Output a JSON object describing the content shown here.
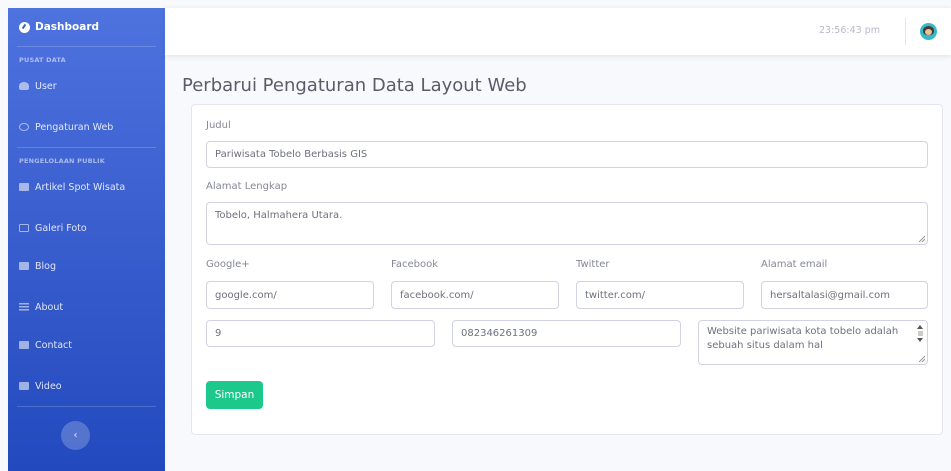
{
  "sidebar": {
    "brand": "Dashboard",
    "heading_1": "PUSAT DATA",
    "heading_2": "PENGELOLAAN PUBLIK",
    "items": {
      "user": "User",
      "web_settings": "Pengaturan Web",
      "articles": "Artikel Spot Wisata",
      "gallery": "Galeri Foto",
      "blog": "Blog",
      "about": "About",
      "contact": "Contact",
      "video": "Video"
    },
    "toggle_symbol": "‹"
  },
  "topbar": {
    "time": "23:56:43 pm"
  },
  "page": {
    "title": "Perbarui Pengaturan Data Layout Web"
  },
  "form": {
    "judul_label": "Judul",
    "judul_value": "Pariwisata Tobelo Berbasis GIS",
    "alamat_label": "Alamat Lengkap",
    "alamat_value": "Tobelo, Halmahera Utara.",
    "google_label": "Google+",
    "google_value": "google.com/",
    "facebook_label": "Facebook",
    "facebook_value": "facebook.com/",
    "twitter_label": "Twitter",
    "twitter_value": "twitter.com/",
    "email_label": "Alamat email",
    "email_value": "hersaltalasi@gmail.com",
    "field_a_value": "9",
    "phone_value": "082346261309",
    "description_value": "Website pariwisata kota tobelo adalah sebuah situs dalam hal",
    "save_label": "Simpan"
  },
  "colors": {
    "sidebar_top": "#4e73df",
    "sidebar_bottom": "#224abe",
    "save_button": "#1cc88a"
  }
}
